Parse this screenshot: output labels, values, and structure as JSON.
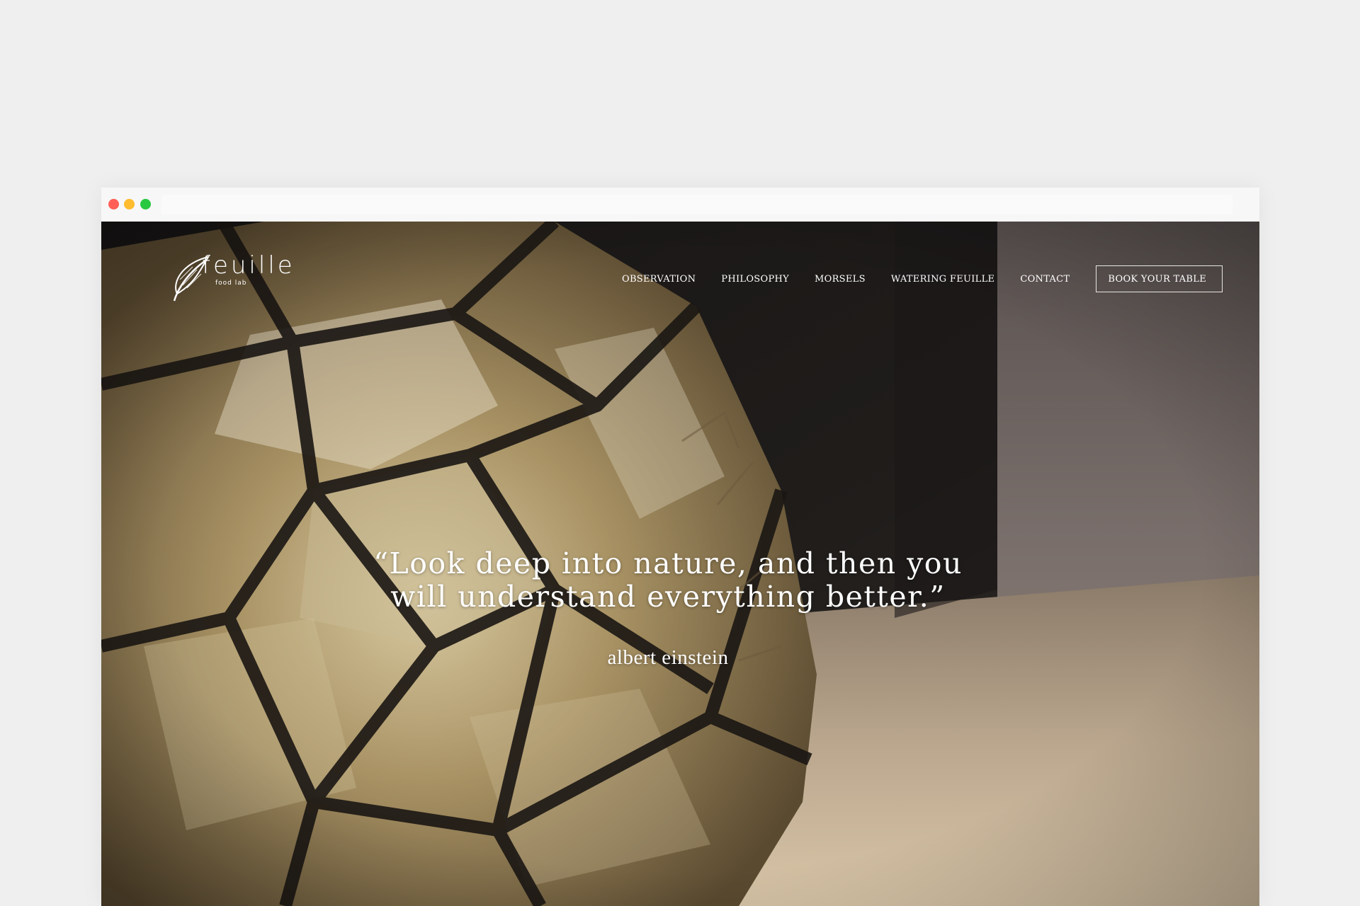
{
  "brand": {
    "name": "feuille",
    "subtitle": "food lab"
  },
  "nav": {
    "items": [
      {
        "label": "OBSERVATION"
      },
      {
        "label": "PHILOSOPHY"
      },
      {
        "label": "MORSELS"
      },
      {
        "label": "WATERING FEUILLE"
      },
      {
        "label": "CONTACT"
      }
    ],
    "cta": "BOOK YOUR TABLE"
  },
  "hero": {
    "quote_line1": "“Look deep into nature, and then you",
    "quote_line2": "will understand everything better.”",
    "author": "albert einstein"
  },
  "colors": {
    "page_background": "#efefef",
    "hero_dark": "#1b1917",
    "text": "#ffffff",
    "window_close": "#ff5f57",
    "window_minimize": "#febc2e",
    "window_maximize": "#28c840"
  }
}
